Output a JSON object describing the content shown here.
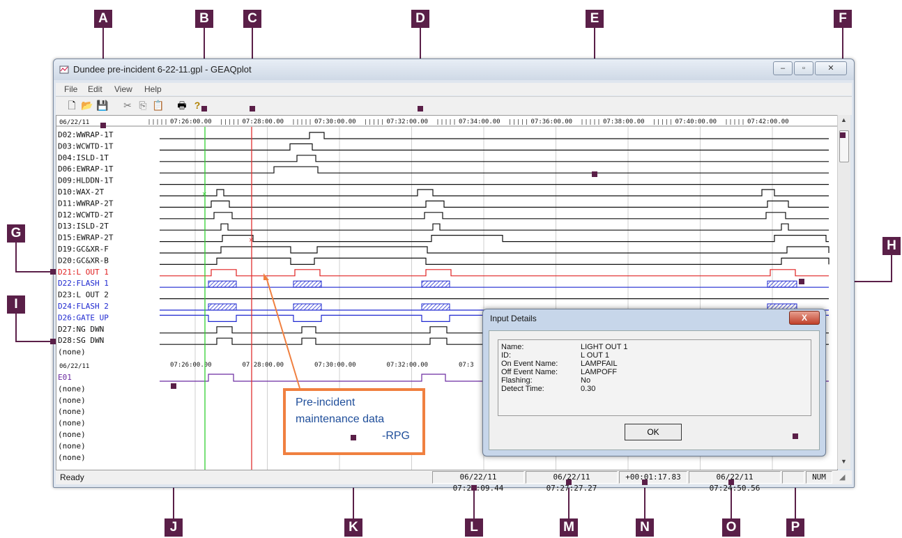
{
  "markers": [
    "A",
    "B",
    "C",
    "D",
    "E",
    "F",
    "G",
    "H",
    "I",
    "J",
    "K",
    "L",
    "M",
    "N",
    "O",
    "P"
  ],
  "window": {
    "title": "Dundee pre-incident 6-22-11.gpl - GEAQplot"
  },
  "menu": [
    "File",
    "Edit",
    "View",
    "Help"
  ],
  "toolbar_icons": [
    "new-file-icon",
    "open-folder-icon",
    "save-icon",
    "cut-icon",
    "copy-icon",
    "paste-icon",
    "print-icon",
    "help-icon"
  ],
  "plot": {
    "date": "06/22/11",
    "time_ticks": [
      "07:26:00.00",
      "07:28:00.00",
      "07:30:00.00",
      "07:32:00.00",
      "07:34:00.00",
      "07:36:00.00",
      "07:38:00.00",
      "07:40:00.00",
      "07:42:00.00"
    ],
    "bottom_ticks": [
      "07:26:00.00",
      "07:28:00.00",
      "07:30:00.00",
      "07:32:00.00",
      "07:3"
    ],
    "digital_channels": [
      {
        "label": "D02:WWRAP-1T",
        "color": "#111111"
      },
      {
        "label": "D03:WCWTD-1T",
        "color": "#111111"
      },
      {
        "label": "D04:ISLD-1T",
        "color": "#111111"
      },
      {
        "label": "D06:EWRAP-1T",
        "color": "#111111"
      },
      {
        "label": "D09:HLDDN-1T",
        "color": "#111111"
      },
      {
        "label": "D10:WAX-2T",
        "color": "#111111"
      },
      {
        "label": "D11:WWRAP-2T",
        "color": "#111111"
      },
      {
        "label": "D12:WCWTD-2T",
        "color": "#111111"
      },
      {
        "label": "D13:ISLD-2T",
        "color": "#111111"
      },
      {
        "label": "D15:EWRAP-2T",
        "color": "#111111"
      },
      {
        "label": "D19:GC&XR-F",
        "color": "#111111"
      },
      {
        "label": "D20:GC&XR-B",
        "color": "#111111"
      },
      {
        "label": "D21:L OUT 1",
        "color": "#e02020"
      },
      {
        "label": "D22:FLASH 1",
        "color": "#1e28d0"
      },
      {
        "label": "D23:L OUT 2",
        "color": "#111111"
      },
      {
        "label": "D24:FLASH 2",
        "color": "#1e28d0"
      },
      {
        "label": "D26:GATE UP",
        "color": "#1e28d0"
      },
      {
        "label": "D27:NG DWN",
        "color": "#111111"
      },
      {
        "label": "D28:SG DWN",
        "color": "#111111"
      },
      {
        "label": "(none)",
        "color": "#111111"
      }
    ],
    "event_channels": [
      "E01",
      "(none)",
      "(none)",
      "(none)",
      "(none)",
      "(none)",
      "(none)",
      "(none)"
    ]
  },
  "callout": {
    "line1": "Pre-incident",
    "line2": "maintenance data",
    "line3": "-RPG"
  },
  "dialog": {
    "title": "Input Details",
    "close": "X",
    "fields": [
      {
        "label": "Name:",
        "value": "LIGHT OUT 1"
      },
      {
        "label": "ID:",
        "value": "L OUT 1"
      },
      {
        "label": "On Event Name:",
        "value": "LAMPFAIL"
      },
      {
        "label": "Off Event Name:",
        "value": "LAMPOFF"
      },
      {
        "label": "Flashing:",
        "value": "No"
      },
      {
        "label": "Detect Time:",
        "value": "0.30"
      }
    ],
    "ok": "OK"
  },
  "status": {
    "ready": "Ready",
    "cursor1": "06/22/11 07:26:09.44",
    "cursor2": "06/22/11 07:27:27.27",
    "delta": "+00:01:17.83",
    "start": "06/22/11 07:24:50.56",
    "num": "NUM"
  }
}
